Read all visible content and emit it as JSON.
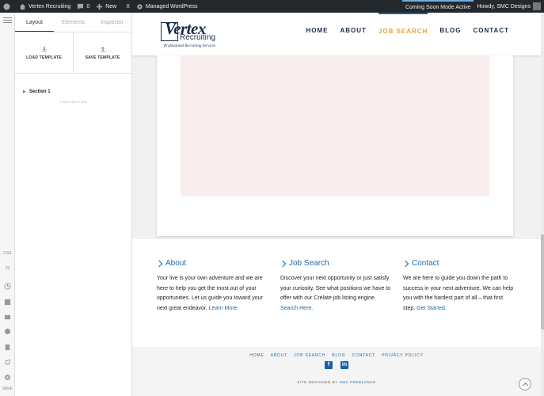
{
  "adminbar": {
    "site_name": "Vertex Recruiting",
    "comments_count": "0",
    "new_label": "New",
    "x_label": "X",
    "managed_label": "Managed WordPress",
    "coming_soon": "Coming Soon Mode Active",
    "howdy": "Howdy, SMC Designs"
  },
  "rail": {
    "css_label": "CSS",
    "js_label": "JS",
    "save_label": "SAVE"
  },
  "panel": {
    "tabs": [
      "Layout",
      "Elements",
      "Inspector"
    ],
    "load_template": "LOAD TEMPLATE",
    "save_template": "SAVE TEMPLATE",
    "section_label": "Section 1",
    "add_section": "+ ADD SECTION"
  },
  "site": {
    "logo_main": "Vertex",
    "logo_sub": "Recruiting",
    "logo_tag": "Professional Recruiting Services",
    "nav": [
      "HOME",
      "ABOUT",
      "JOB SEARCH",
      "BLOG",
      "CONTACT"
    ],
    "nav_active": "JOB SEARCH",
    "footer": {
      "about": {
        "title": "About",
        "text": "Your live is your own adventure and we are here to help you get the most out of your opportunities. Let us guide you toward your next great endeavor. ",
        "link": "Learn More."
      },
      "job": {
        "title": "Job Search",
        "text": "Discover your next opportunity or just satisfy your curiosity. See what positions we have to offer with our Crelate job listing engine. ",
        "link": "Search Here."
      },
      "contact": {
        "title": "Contact",
        "text": "We are here to guide you down the path to success in your next adventure. We can help you with the hardest part of all – that first step. ",
        "link": "Get Started."
      },
      "links": [
        "HOME",
        "ABOUT",
        "JOB SEARCH",
        "BLOG",
        "CONTACT",
        "PRIVACY POLICY"
      ],
      "designed_by": "SITE DESIGNED BY ",
      "designer": "SMC FREELANCE"
    }
  },
  "colors": {
    "navy": "#1a2b4c",
    "accent": "#e8a23a",
    "link": "#1b6aa8"
  }
}
